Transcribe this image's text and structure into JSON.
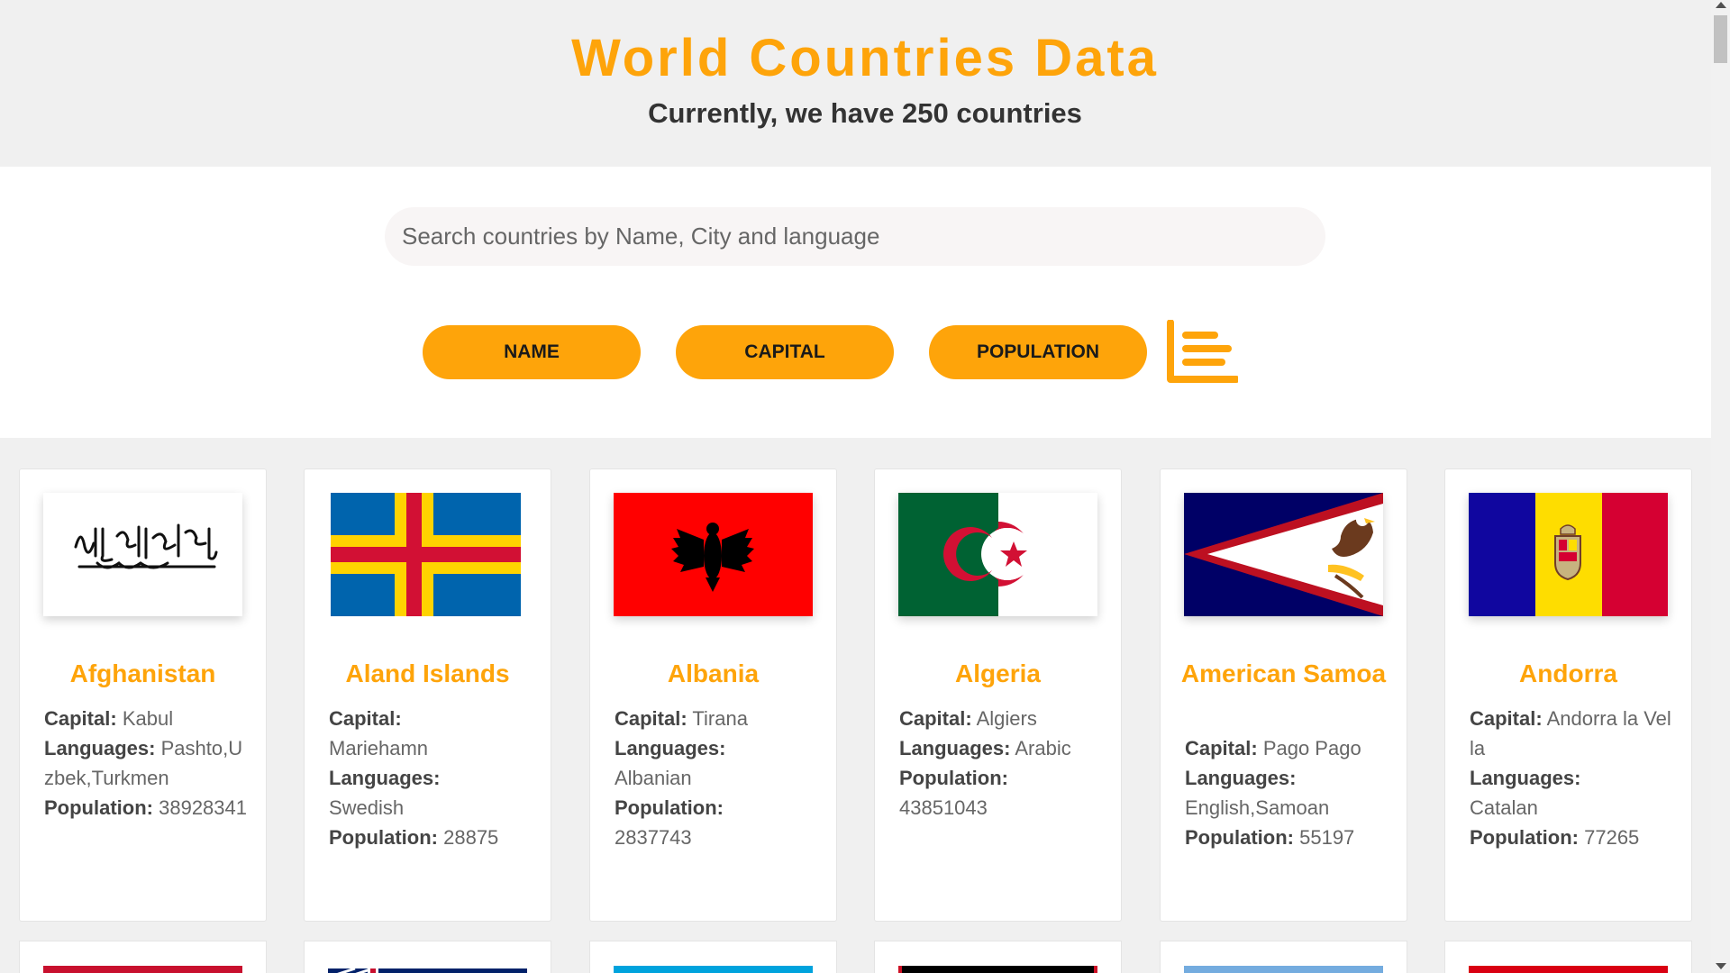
{
  "header": {
    "title": "World Countries Data",
    "subtitle": "Currently, we have 250 countries"
  },
  "search": {
    "placeholder": "Search countries by Name, City and language",
    "value": ""
  },
  "sort_buttons": {
    "name": "NAME",
    "capital": "CAPITAL",
    "population": "POPULATION"
  },
  "labels": {
    "capital": "Capital:",
    "languages": "Languages:",
    "population": "Population:"
  },
  "colors": {
    "accent": "#fea40a"
  },
  "countries": [
    {
      "name": "Afghanistan",
      "capital": "Kabul",
      "languages": "Pashto,Uzbek,Turkmen",
      "population": "38928341",
      "flag": "afghanistan-flag"
    },
    {
      "name": "Aland Islands",
      "capital": "Mariehamn",
      "languages": "Swedish",
      "population": "28875",
      "flag": "aland-flag"
    },
    {
      "name": "Albania",
      "capital": "Tirana",
      "languages": "Albanian",
      "population": "2837743",
      "flag": "albania-flag"
    },
    {
      "name": "Algeria",
      "capital": "Algiers",
      "languages": "Arabic",
      "population": "43851043",
      "flag": "algeria-flag"
    },
    {
      "name": "American Samoa",
      "capital": "Pago Pago",
      "languages": "English,Samoan",
      "population": "55197",
      "flag": "american-samoa-flag"
    },
    {
      "name": "Andorra",
      "capital": "Andorra la Vella",
      "languages": "Catalan",
      "population": "77265",
      "flag": "andorra-flag"
    }
  ]
}
